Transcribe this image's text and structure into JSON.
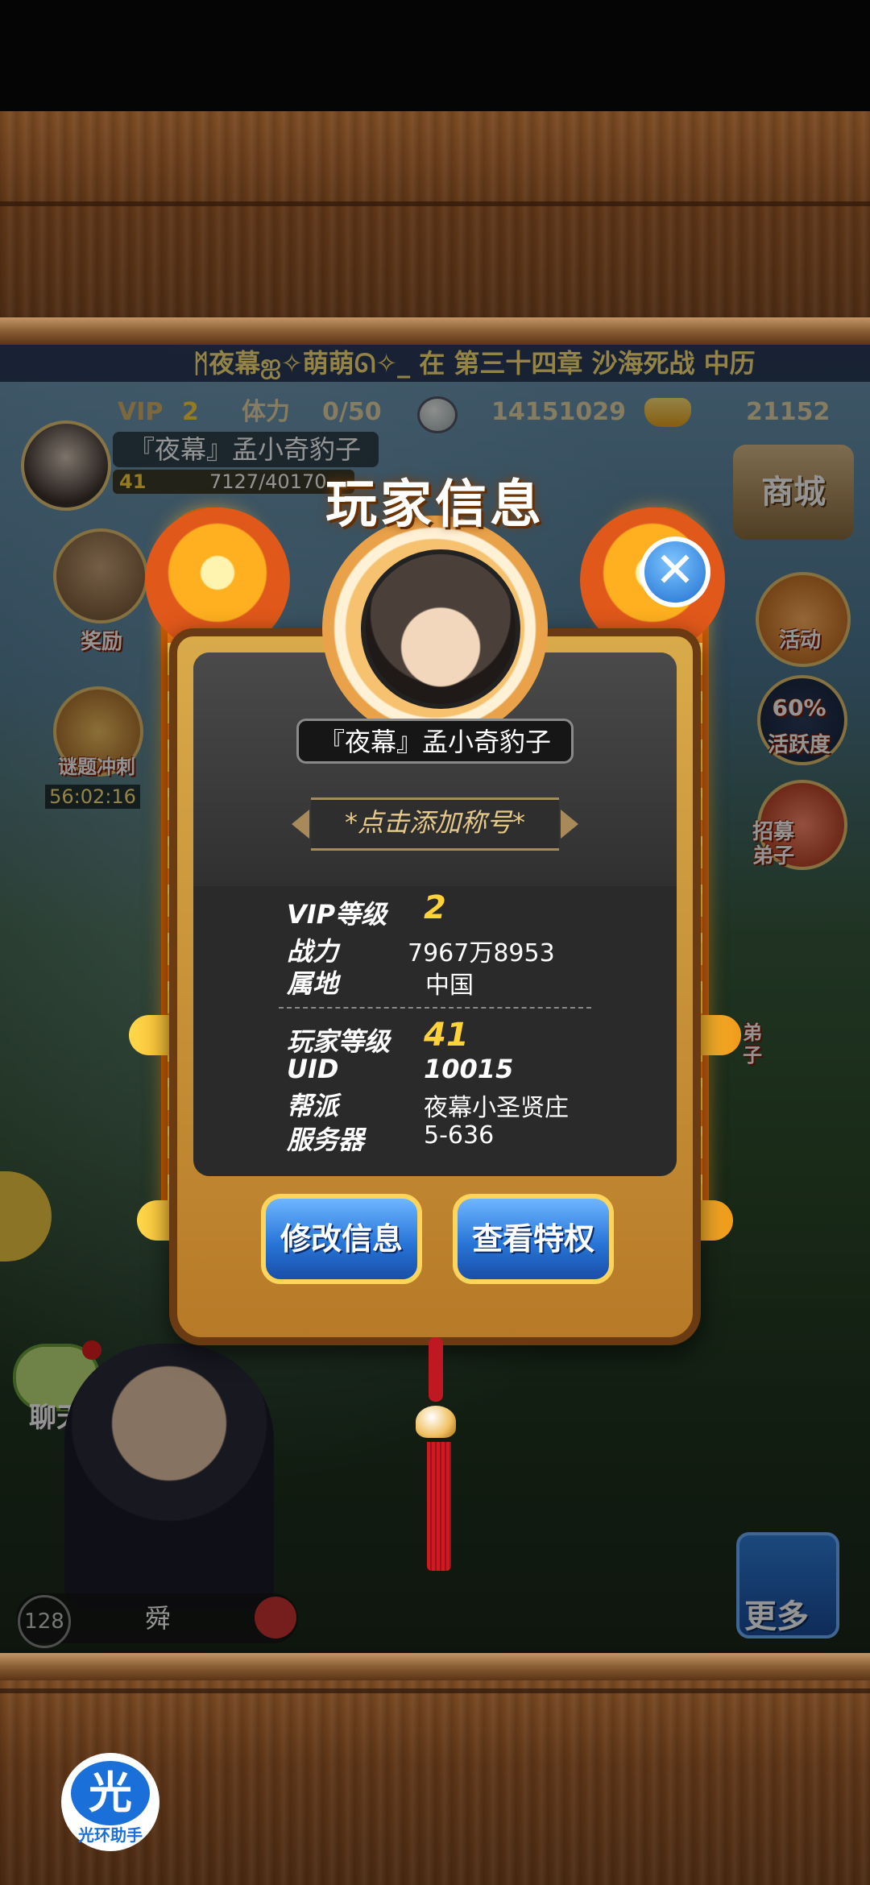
{
  "ticker": {
    "text": "ᛗ夜幕ஐ✧萌萌ᘏ✧_ 在 第三十四章 沙海死战 中历"
  },
  "status": {
    "vip_label": "VIP",
    "vip_value": "2",
    "stamina_label": "体力",
    "stamina_value": "0/50",
    "silver": "14151029",
    "gold": "21152"
  },
  "player_top": {
    "name": "『夜幕』孟小奇豹子",
    "level": "41",
    "exp": "7127/40170"
  },
  "side_left": [
    {
      "label": "奖励"
    },
    {
      "label": "谜题冲刺",
      "timer": "56:02:16"
    }
  ],
  "side_right": [
    {
      "label": "商城"
    },
    {
      "label": "活动"
    },
    {
      "label": "活跃度",
      "percent": "60%"
    },
    {
      "label": "招募弟子"
    },
    {
      "label": "弟子"
    }
  ],
  "chat": {
    "label": "聊天"
  },
  "more": {
    "label": "更多"
  },
  "hero": {
    "level": "128",
    "name": "舜"
  },
  "dialog": {
    "title": "玩家信息",
    "name": "『夜幕』孟小奇豹子",
    "title_hint": "*点击添加称号*",
    "rows_top": [
      {
        "label": "VIP等级",
        "value": "2"
      },
      {
        "label": "战力",
        "value": "7967万8953"
      },
      {
        "label": "属地",
        "value": "中国"
      }
    ],
    "rows_bottom": [
      {
        "label": "玩家等级",
        "value": "41"
      },
      {
        "label": "UID",
        "value": "10015"
      },
      {
        "label": "帮派",
        "value": "夜幕小圣贤庄"
      },
      {
        "label": "服务器",
        "value": "5-636"
      }
    ],
    "btn_edit": "修改信息",
    "btn_privilege": "查看特权",
    "close_symbol": "✕"
  },
  "watermark": {
    "glyph": "光",
    "text": "光环助手"
  }
}
